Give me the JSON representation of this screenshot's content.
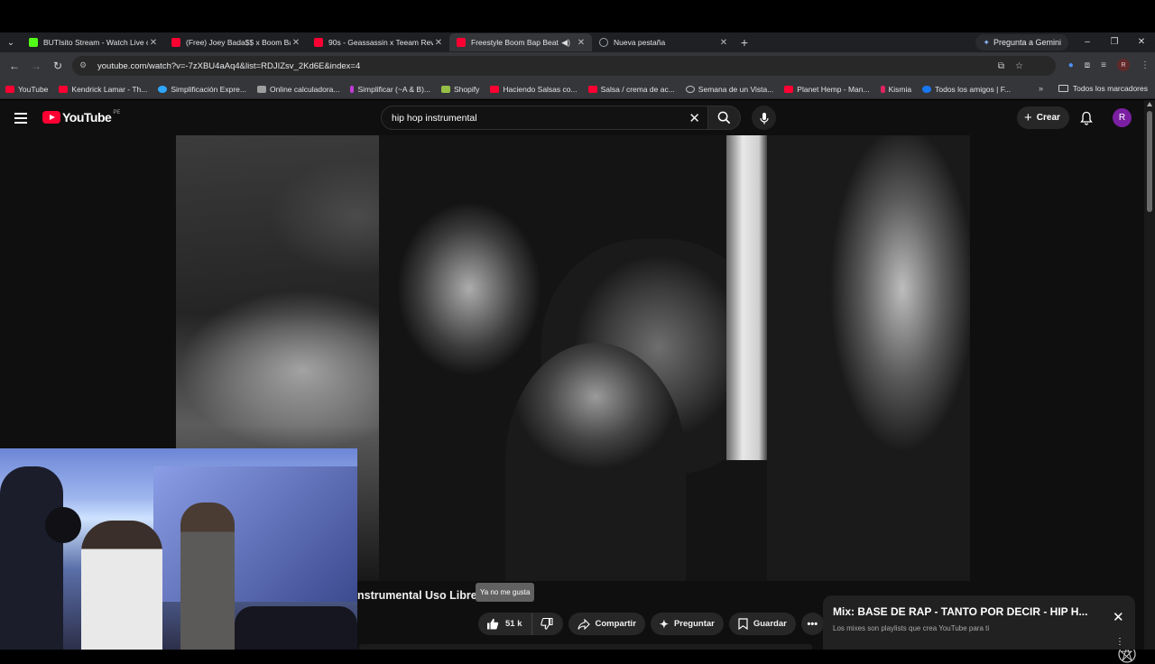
{
  "browser": {
    "tabs": [
      {
        "title": "BUTIsito Stream - Watch Live o",
        "favicon_color": "#53fc18",
        "active": false
      },
      {
        "title": "(Free) Joey Bada$$ x Boom Bap",
        "favicon_color": "#ff0033",
        "active": false
      },
      {
        "title": "90s - Geassassin x Teeam Revol",
        "favicon_color": "#ff0033",
        "active": false
      },
      {
        "title": "Freestyle Boom Bap Beat |",
        "favicon_color": "#ff0033",
        "active": true,
        "audio": true
      },
      {
        "title": "Nueva pestaña",
        "favicon_color": "#9aa0a6",
        "active": false
      }
    ],
    "gemini_label": "Pregunta a Gemini",
    "url": "youtube.com/watch?v=-7zXBU4aAq4&list=RDJIZsv_2Kd6E&index=4",
    "profile_initial": "R",
    "bookmarks": [
      {
        "label": "YouTube",
        "color": "#ff0033"
      },
      {
        "label": "Kendrick Lamar - Th...",
        "color": "#ff0033"
      },
      {
        "label": "Simplificación Expre...",
        "color": "#2fa7ff"
      },
      {
        "label": "Online calculadora...",
        "color": "#9e9e9e"
      },
      {
        "label": "Simplificar (~A & B)...",
        "color": "#c43bd6"
      },
      {
        "label": "Shopify",
        "color": "#95bf47"
      },
      {
        "label": "Haciendo Salsas co...",
        "color": "#ff0033"
      },
      {
        "label": "Salsa / crema de ac...",
        "color": "#ff0033"
      },
      {
        "label": "Semana de un Vista...",
        "color": "#bdbdbd"
      },
      {
        "label": "Planet Hemp - Man...",
        "color": "#ff0033"
      },
      {
        "label": "Kismia",
        "color": "#e0245e"
      },
      {
        "label": "Todos los amigos | F...",
        "color": "#1877f2"
      }
    ],
    "bookmarks_more": "»",
    "all_bookmarks": "Todos los marcadores"
  },
  "youtube": {
    "logo_text": "YouTube",
    "region": "PE",
    "search_query": "hip hop instrumental",
    "create_label": "Crear",
    "avatar_initial": "R",
    "video_title": "nstrumental Uso Libre",
    "tooltip": "Ya no me gusta",
    "like_count": "51 k",
    "share_label": "Compartir",
    "ask_label": "Preguntar",
    "save_label": "Guardar",
    "mix": {
      "title": "Mix: BASE DE RAP - TANTO POR DECIR - HIP H...",
      "subtitle": "Los mixes son playlists que crea YouTube para ti"
    }
  },
  "colors": {
    "accent": "#ff0033",
    "avatar": "#7b1fa2"
  }
}
